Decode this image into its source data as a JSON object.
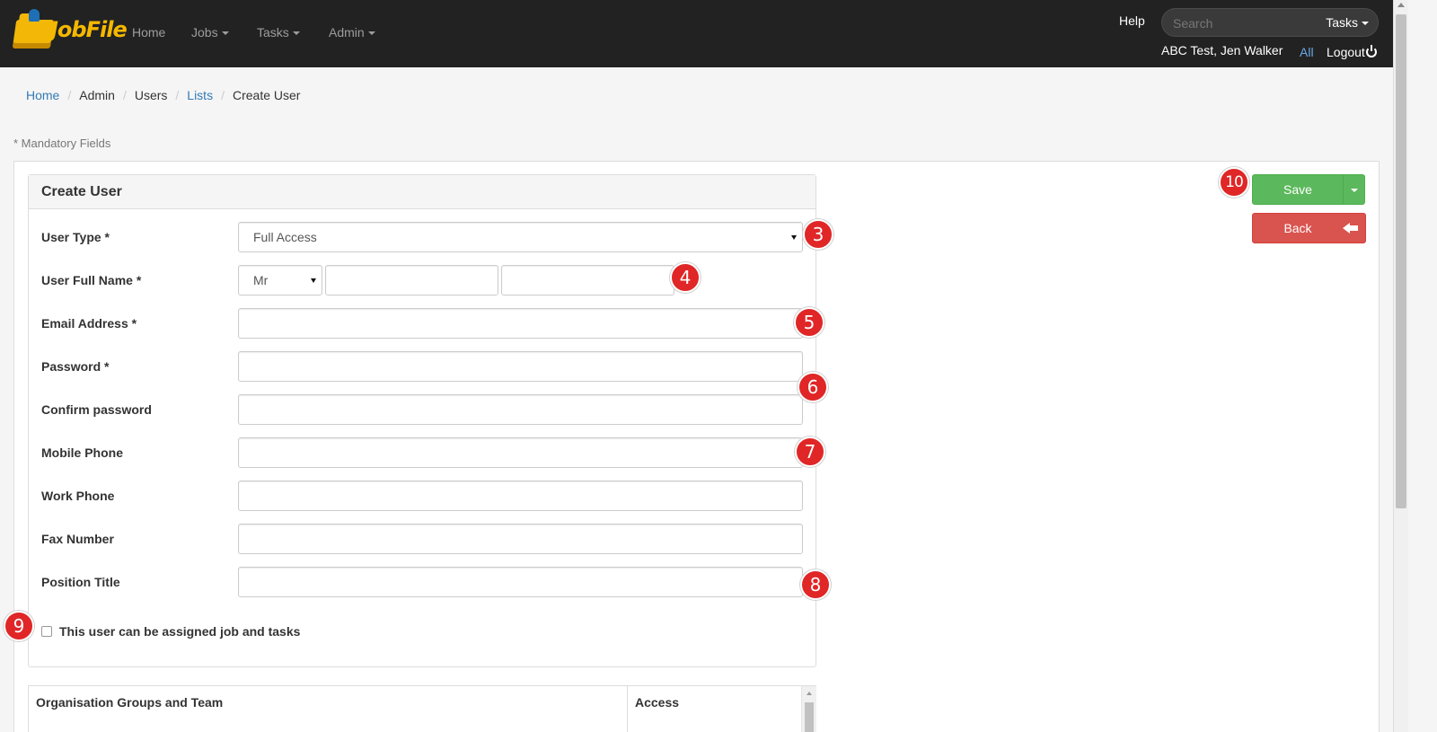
{
  "app": {
    "logo_text": "JobFile"
  },
  "nav": {
    "home": "Home",
    "jobs": "Jobs",
    "tasks": "Tasks",
    "admin": "Admin",
    "help": "Help",
    "search_placeholder": "Search",
    "search_scope": "Tasks",
    "user": "ABC Test, Jen Walker",
    "all": "All",
    "logout": "Logout"
  },
  "breadcrumb": {
    "items": [
      "Home",
      "Admin",
      "Users",
      "Lists",
      "Create User"
    ],
    "sep": "/"
  },
  "mandatory_note": "* Mandatory Fields",
  "form": {
    "title": "Create User",
    "user_type": {
      "label": "User Type *",
      "value": "Full Access"
    },
    "full_name": {
      "label": "User Full Name *",
      "title_value": "Mr",
      "first": "",
      "last": ""
    },
    "email": {
      "label": "Email Address *",
      "value": ""
    },
    "password": {
      "label": "Password *",
      "value": ""
    },
    "confirm_password": {
      "label": "Confirm password",
      "value": ""
    },
    "mobile": {
      "label": "Mobile Phone",
      "value": ""
    },
    "work": {
      "label": "Work Phone",
      "value": ""
    },
    "fax": {
      "label": "Fax Number",
      "value": ""
    },
    "position": {
      "label": "Position Title",
      "value": ""
    },
    "assignable": {
      "label": "This user can be assigned job and tasks",
      "checked": false
    }
  },
  "actions": {
    "save": "Save",
    "back": "Back"
  },
  "markers": [
    "3",
    "4",
    "5",
    "6",
    "7",
    "8",
    "9",
    "10"
  ],
  "table": {
    "col1": "Organisation Groups and Team",
    "col2": "Access"
  },
  "colors": {
    "navbar": "#222222",
    "save": "#5cb85c",
    "back": "#d9534f",
    "marker": "#e02626",
    "link": "#337ab7"
  }
}
